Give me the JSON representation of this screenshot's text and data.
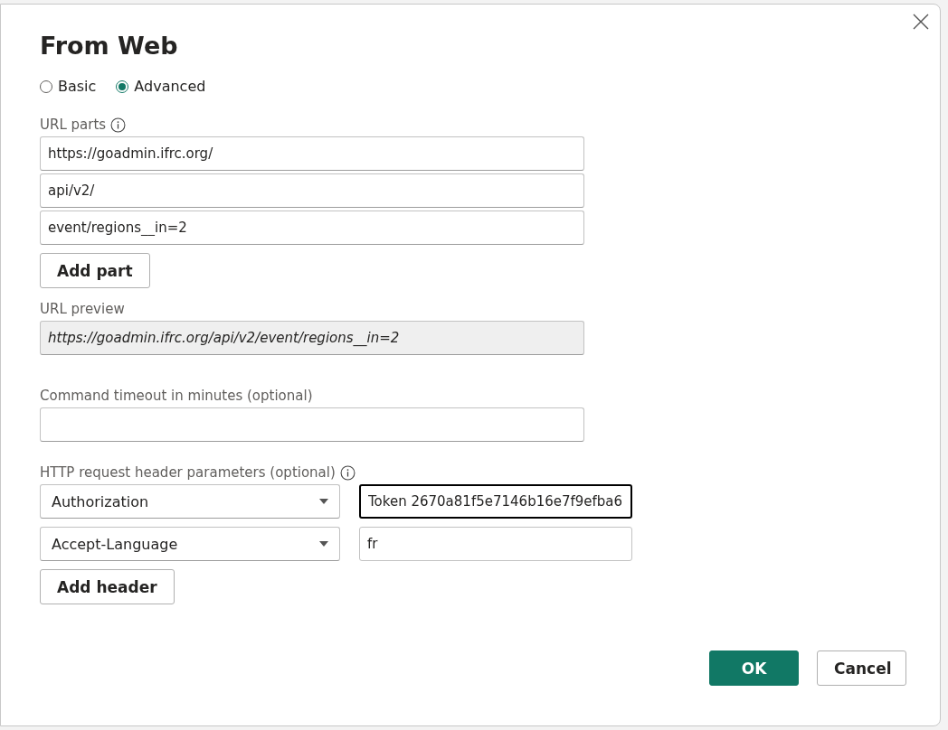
{
  "dialog": {
    "title": "From Web"
  },
  "modes": [
    {
      "label": "Basic",
      "selected": false
    },
    {
      "label": "Advanced",
      "selected": true
    }
  ],
  "url_parts": {
    "label": "URL parts",
    "values": [
      "https://goadmin.ifrc.org/",
      "api/v2/",
      "event/regions__in=2"
    ],
    "add_button": "Add part"
  },
  "url_preview": {
    "label": "URL preview",
    "value": "https://goadmin.ifrc.org/api/v2/event/regions__in=2"
  },
  "timeout": {
    "label": "Command timeout in minutes (optional)"
  },
  "headers": {
    "label": "HTTP request header parameters (optional)",
    "rows": [
      {
        "name": "Authorization",
        "value": "Token 2670a81f5e7146b16e7f9efba6",
        "focused": true
      },
      {
        "name": "Accept-Language",
        "value": "fr",
        "focused": false
      }
    ],
    "add_button": "Add header"
  },
  "buttons": [
    {
      "label": "OK",
      "kind": "primary"
    },
    {
      "label": "Cancel",
      "kind": "secondary"
    }
  ]
}
